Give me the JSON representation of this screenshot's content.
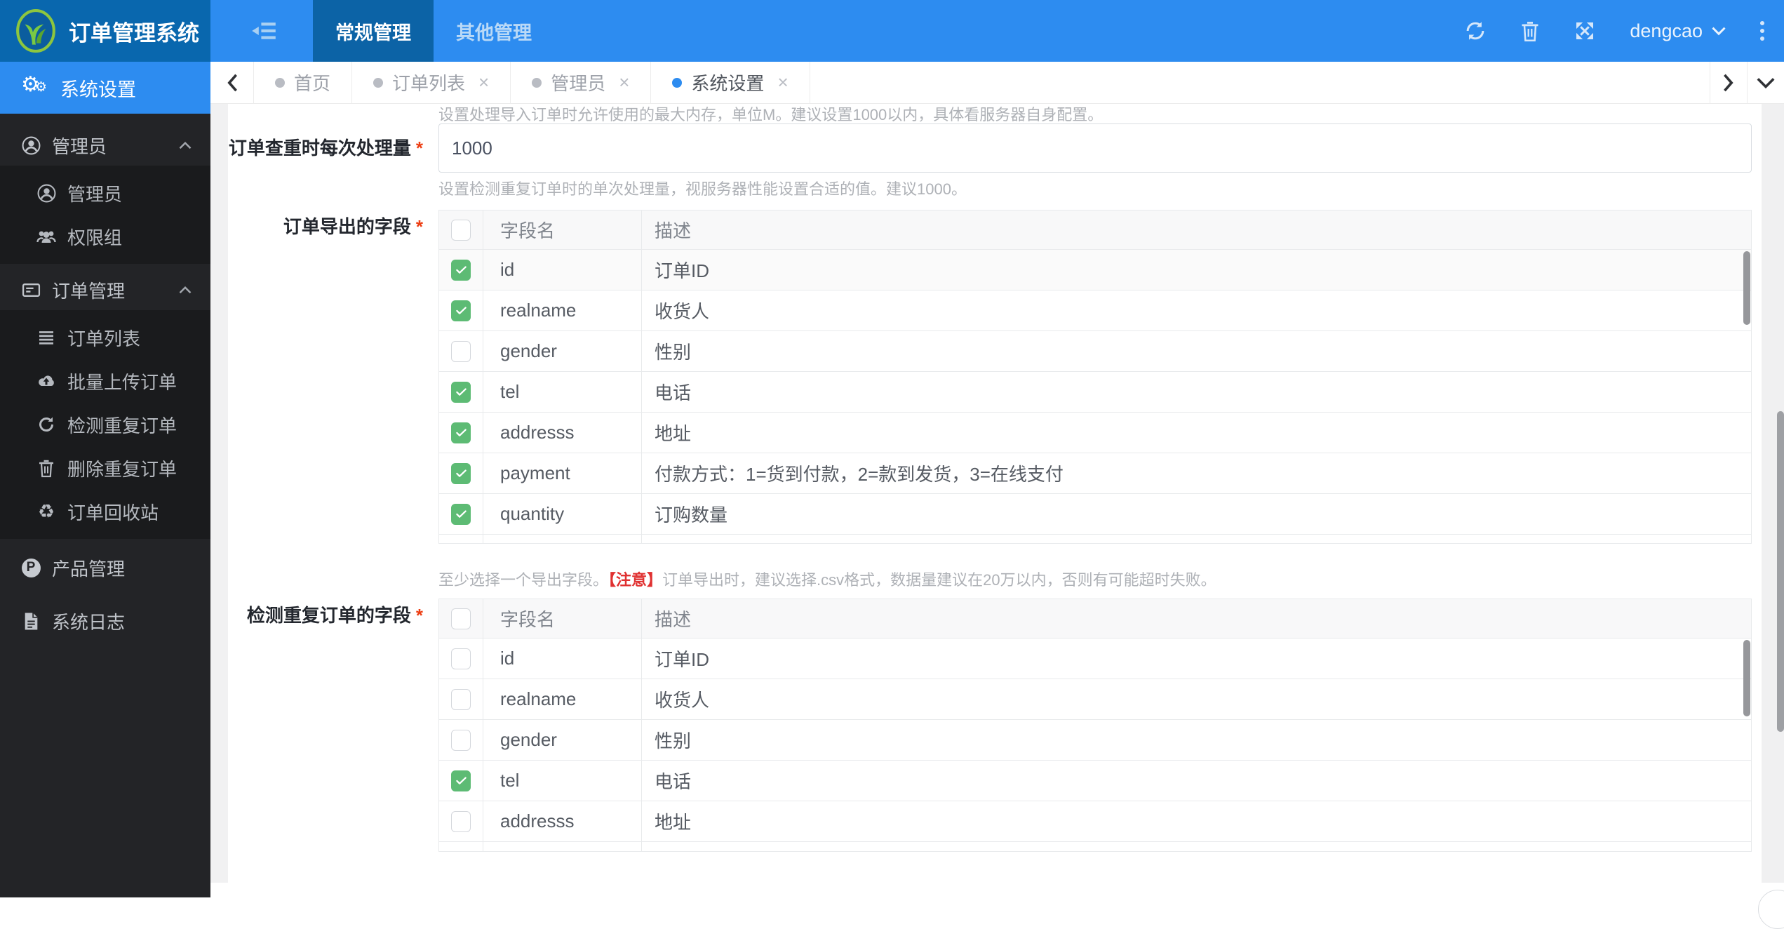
{
  "app": {
    "title": "订单管理系统",
    "user": "dengcao"
  },
  "colors": {
    "header_blue": "#2d8cf0",
    "header_dark_blue": "#0967ae",
    "menu_active_blue": "#0c63a6",
    "sidebar_bg": "#232427",
    "submenu_bg": "#1a1b1d",
    "active_item_blue": "#2d8cf0",
    "check_green": "#5dbb74",
    "required_red": "#ed3f14",
    "warn_red": "#e03131"
  },
  "top_menu": {
    "items": [
      {
        "key": "general",
        "label": "常规管理",
        "active": true
      },
      {
        "key": "other",
        "label": "其他管理",
        "active": false
      }
    ]
  },
  "tabs": {
    "close_glyph": "×",
    "items": [
      {
        "key": "home",
        "label": "首页",
        "closable": false,
        "active": false
      },
      {
        "key": "order-list",
        "label": "订单列表",
        "closable": true,
        "active": false
      },
      {
        "key": "admin",
        "label": "管理员",
        "closable": true,
        "active": false
      },
      {
        "key": "system-settings",
        "label": "系统设置",
        "closable": true,
        "active": true
      }
    ]
  },
  "sidebar": {
    "active_item": {
      "key": "system-settings",
      "label": "系统设置",
      "icon": "gear-icon"
    },
    "groups": [
      {
        "key": "admin",
        "label": "管理员",
        "icon": "admin-icon",
        "expanded": true,
        "children": [
          {
            "key": "admin-list",
            "label": "管理员",
            "icon": "user-circle-icon"
          },
          {
            "key": "permission-group",
            "label": "权限组",
            "icon": "users-icon"
          }
        ]
      },
      {
        "key": "orders",
        "label": "订单管理",
        "icon": "orders-icon",
        "expanded": true,
        "children": [
          {
            "key": "order-list",
            "label": "订单列表",
            "icon": "list-icon"
          },
          {
            "key": "bulk-upload-orders",
            "label": "批量上传订单",
            "icon": "cloud-upload-icon"
          },
          {
            "key": "detect-duplicate-orders",
            "label": "检测重复订单",
            "icon": "rotate-icon"
          },
          {
            "key": "delete-duplicate-orders",
            "label": "删除重复订单",
            "icon": "trash-icon"
          },
          {
            "key": "order-recycle-bin",
            "label": "订单回收站",
            "icon": "recycle-icon"
          }
        ]
      },
      {
        "key": "products",
        "label": "产品管理",
        "icon": "product-icon",
        "expanded": false,
        "children": []
      },
      {
        "key": "system-logs",
        "label": "系统日志",
        "icon": "log-icon",
        "expanded": false,
        "children": []
      }
    ]
  },
  "form": {
    "top_help": "设置处理导入订单时允许使用的最大内存，单位M。建议设置1000以内，具体看服务器自身配置。",
    "batch_field": {
      "label": "订单查重时每次处理量",
      "required": "*",
      "value": "1000",
      "help": "设置检测重复订单时的单次处理量，视服务器性能设置合适的值。建议1000。"
    },
    "export_note": {
      "prefix": "至少选择一个导出字段。",
      "warn": "【注意】",
      "suffix": "订单导出时，建议选择.csv格式，数据量建议在20万以内，否则有可能超时失败。"
    }
  },
  "tables": {
    "columns": {
      "field": "字段名",
      "desc": "描述"
    },
    "export": {
      "label": "订单导出的字段",
      "required": "*",
      "rows": [
        {
          "field": "id",
          "desc": "订单ID",
          "checked": true
        },
        {
          "field": "realname",
          "desc": "收货人",
          "checked": true
        },
        {
          "field": "gender",
          "desc": "性别",
          "checked": false
        },
        {
          "field": "tel",
          "desc": "电话",
          "checked": true
        },
        {
          "field": "addresss",
          "desc": "地址",
          "checked": true
        },
        {
          "field": "payment",
          "desc": "付款方式：1=货到付款，2=款到发货，3=在线支付",
          "checked": true
        },
        {
          "field": "quantity",
          "desc": "订购数量",
          "checked": true
        }
      ]
    },
    "duplicate": {
      "label": "检测重复订单的字段",
      "required": "*",
      "rows": [
        {
          "field": "id",
          "desc": "订单ID",
          "checked": false
        },
        {
          "field": "realname",
          "desc": "收货人",
          "checked": false
        },
        {
          "field": "gender",
          "desc": "性别",
          "checked": false
        },
        {
          "field": "tel",
          "desc": "电话",
          "checked": true
        },
        {
          "field": "addresss",
          "desc": "地址",
          "checked": false
        }
      ]
    }
  }
}
